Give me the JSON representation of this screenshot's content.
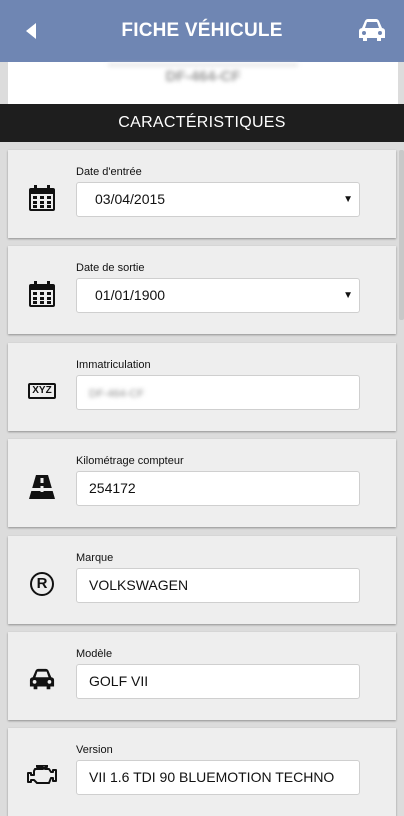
{
  "header": {
    "title": "FICHE VÉHICULE",
    "back_icon": "back-arrow-icon",
    "action_icon": "car-icon",
    "background": "#6f86b3"
  },
  "plate_preview": {
    "text": "DF-464-CF"
  },
  "section": {
    "title": "CARACTÉRISTIQUES"
  },
  "fields": [
    {
      "label": "Date d'entrée",
      "value": "03/04/2015",
      "type": "select",
      "icon": "calendar-icon"
    },
    {
      "label": "Date de sortie",
      "value": "01/01/1900",
      "type": "select",
      "icon": "calendar-icon"
    },
    {
      "label": "Immatriculation",
      "value": "DF-464-CF",
      "type": "text",
      "icon": "license-plate-icon",
      "placeholder_icon_text": "XYZ"
    },
    {
      "label": "Kilométrage compteur",
      "value": "254172",
      "type": "text",
      "icon": "road-icon"
    },
    {
      "label": "Marque",
      "value": "VOLKSWAGEN",
      "type": "text",
      "icon": "registered-icon",
      "icon_glyph": "R"
    },
    {
      "label": "Modèle",
      "value": "GOLF VII",
      "type": "text",
      "icon": "car-icon"
    },
    {
      "label": "Version",
      "value": "VII 1.6 TDI 90 BLUEMOTION TECHNO",
      "type": "text",
      "icon": "engine-icon"
    }
  ]
}
